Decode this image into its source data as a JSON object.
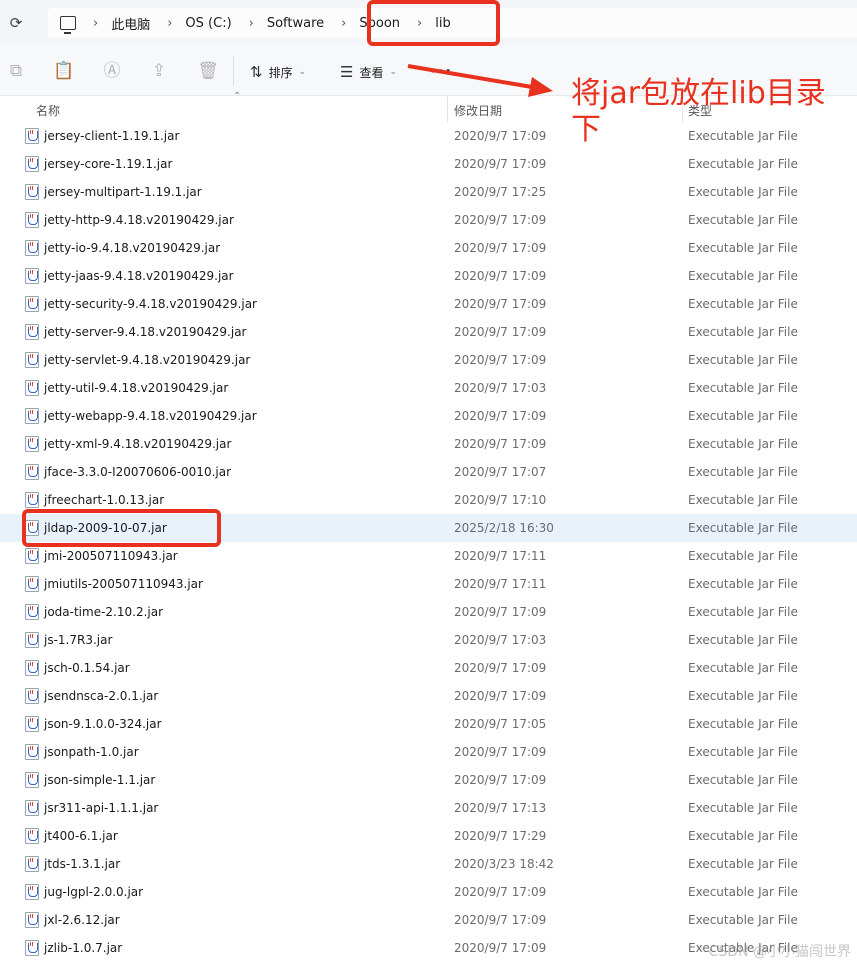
{
  "breadcrumbs": [
    "此电脑",
    "OS (C:)",
    "Software",
    "Spoon",
    "lib"
  ],
  "toolbar": {
    "sort_label": "排序",
    "view_label": "查看",
    "more_label": "···"
  },
  "columns": {
    "name": "名称",
    "date": "修改日期",
    "type": "类型"
  },
  "files": [
    {
      "name": "jersey-client-1.19.1.jar",
      "date": "2020/9/7 17:09",
      "type": "Executable Jar File"
    },
    {
      "name": "jersey-core-1.19.1.jar",
      "date": "2020/9/7 17:09",
      "type": "Executable Jar File"
    },
    {
      "name": "jersey-multipart-1.19.1.jar",
      "date": "2020/9/7 17:25",
      "type": "Executable Jar File"
    },
    {
      "name": "jetty-http-9.4.18.v20190429.jar",
      "date": "2020/9/7 17:09",
      "type": "Executable Jar File"
    },
    {
      "name": "jetty-io-9.4.18.v20190429.jar",
      "date": "2020/9/7 17:09",
      "type": "Executable Jar File"
    },
    {
      "name": "jetty-jaas-9.4.18.v20190429.jar",
      "date": "2020/9/7 17:09",
      "type": "Executable Jar File"
    },
    {
      "name": "jetty-security-9.4.18.v20190429.jar",
      "date": "2020/9/7 17:09",
      "type": "Executable Jar File"
    },
    {
      "name": "jetty-server-9.4.18.v20190429.jar",
      "date": "2020/9/7 17:09",
      "type": "Executable Jar File"
    },
    {
      "name": "jetty-servlet-9.4.18.v20190429.jar",
      "date": "2020/9/7 17:09",
      "type": "Executable Jar File"
    },
    {
      "name": "jetty-util-9.4.18.v20190429.jar",
      "date": "2020/9/7 17:03",
      "type": "Executable Jar File"
    },
    {
      "name": "jetty-webapp-9.4.18.v20190429.jar",
      "date": "2020/9/7 17:09",
      "type": "Executable Jar File"
    },
    {
      "name": "jetty-xml-9.4.18.v20190429.jar",
      "date": "2020/9/7 17:09",
      "type": "Executable Jar File"
    },
    {
      "name": "jface-3.3.0-I20070606-0010.jar",
      "date": "2020/9/7 17:07",
      "type": "Executable Jar File"
    },
    {
      "name": "jfreechart-1.0.13.jar",
      "date": "2020/9/7 17:10",
      "type": "Executable Jar File"
    },
    {
      "name": "jldap-2009-10-07.jar",
      "date": "2025/2/18 16:30",
      "type": "Executable Jar File",
      "selected": true
    },
    {
      "name": "jmi-200507110943.jar",
      "date": "2020/9/7 17:11",
      "type": "Executable Jar File"
    },
    {
      "name": "jmiutils-200507110943.jar",
      "date": "2020/9/7 17:11",
      "type": "Executable Jar File"
    },
    {
      "name": "joda-time-2.10.2.jar",
      "date": "2020/9/7 17:09",
      "type": "Executable Jar File"
    },
    {
      "name": "js-1.7R3.jar",
      "date": "2020/9/7 17:03",
      "type": "Executable Jar File"
    },
    {
      "name": "jsch-0.1.54.jar",
      "date": "2020/9/7 17:09",
      "type": "Executable Jar File"
    },
    {
      "name": "jsendnsca-2.0.1.jar",
      "date": "2020/9/7 17:09",
      "type": "Executable Jar File"
    },
    {
      "name": "json-9.1.0.0-324.jar",
      "date": "2020/9/7 17:05",
      "type": "Executable Jar File"
    },
    {
      "name": "jsonpath-1.0.jar",
      "date": "2020/9/7 17:09",
      "type": "Executable Jar File"
    },
    {
      "name": "json-simple-1.1.jar",
      "date": "2020/9/7 17:09",
      "type": "Executable Jar File"
    },
    {
      "name": "jsr311-api-1.1.1.jar",
      "date": "2020/9/7 17:13",
      "type": "Executable Jar File"
    },
    {
      "name": "jt400-6.1.jar",
      "date": "2020/9/7 17:29",
      "type": "Executable Jar File"
    },
    {
      "name": "jtds-1.3.1.jar",
      "date": "2020/3/23 18:42",
      "type": "Executable Jar File"
    },
    {
      "name": "jug-lgpl-2.0.0.jar",
      "date": "2020/9/7 17:09",
      "type": "Executable Jar File"
    },
    {
      "name": "jxl-2.6.12.jar",
      "date": "2020/9/7 17:09",
      "type": "Executable Jar File"
    },
    {
      "name": "jzlib-1.0.7.jar",
      "date": "2020/9/7 17:09",
      "type": "Executable Jar File"
    }
  ],
  "annotation": {
    "text": "将jar包放在lib目录下",
    "color": "#e8321f"
  },
  "watermark": "CSDN @小小猫闯世界",
  "colors": {
    "selected_row": "#e9f2fb",
    "accent": "#e8321f"
  }
}
